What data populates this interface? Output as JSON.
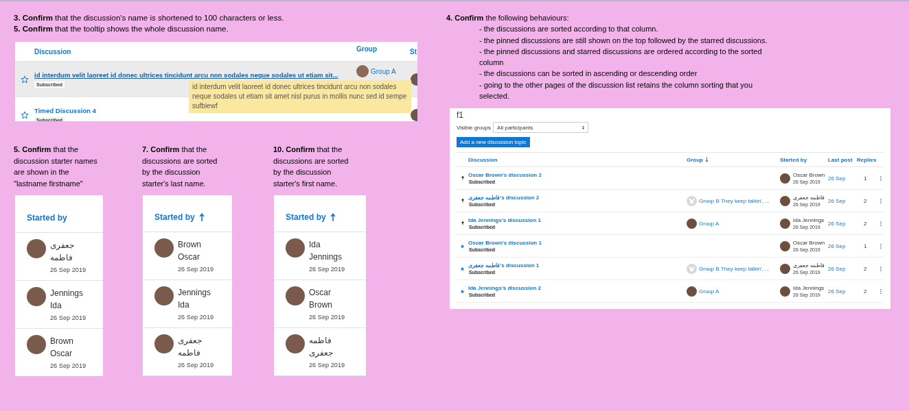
{
  "tooltip_step": {
    "instructions": [
      "**3. Confirm** that the discussion's name is shortened to 100 characters or less.",
      "**5. Confirm** that the tooltip shows the  whole discussion name."
    ],
    "columns": [
      {
        "label": "Discussion"
      },
      {
        "label": "Group"
      },
      {
        "label": "St"
      }
    ],
    "rows": [
      {
        "starred": false,
        "hovered": true,
        "title": "id interdum velit laoreet id donec ultrices tincidunt arcu non sodales neque sodales ut etiam sit...",
        "badge": "Subscribed",
        "group": "Group A"
      },
      {
        "starred": false,
        "hovered": false,
        "title": "Timed Discussion 4",
        "badge": "Subscribed"
      }
    ],
    "tooltip": "id interdum velit laoreet id donec ultrices tincidunt arcu non sodales neque sodales ut etiam sit amet nisl purus in mollis nunc sed id sempe sufbiewf"
  },
  "name_steps": [
    {
      "instruction": "**5. Confirm** that the discussion starter names are shown in the \"lastname firstname\"",
      "header": "Started by",
      "sorted": false,
      "entries": [
        {
          "name": "جعفری فاطمه",
          "date": "26 Sep 2019"
        },
        {
          "name": "Jennings Ida",
          "date": "26 Sep 2019"
        },
        {
          "name": "Brown Oscar",
          "date": "26 Sep 2019"
        }
      ]
    },
    {
      "instruction": "**7. Confirm** that the discussions are sorted by the discussion starter's last name.",
      "header": "Started by",
      "sorted": true,
      "descending": false,
      "entries": [
        {
          "name": "Brown Oscar",
          "date": "26 Sep 2019"
        },
        {
          "name": "Jennings Ida",
          "date": "26 Sep 2019"
        },
        {
          "name": "جعفری فاطمه",
          "date": "26 Sep 2019"
        }
      ]
    },
    {
      "instruction": "**10. Confirm** that the discussions are sorted by the discussion starter's first name.",
      "header": "Started by",
      "sorted": true,
      "descending": false,
      "entries": [
        {
          "name": "Ida Jennings",
          "date": "26 Sep 2019"
        },
        {
          "name": "Oscar Brown",
          "date": "26 Sep 2019"
        },
        {
          "name": "فاطمه جعفری",
          "date": "26 Sep 2019"
        }
      ]
    }
  ],
  "sort_step": {
    "intro": "**4. Confirm** the following behaviours:",
    "bullets": [
      "- the discussions are sorted according to that column.",
      "- the pinned discussions are still shown on the top followed by the starred discussions.",
      "- the pinned discussions and starred discussions are ordered according to the sorted column",
      "- the discussions can be sorted in ascending or descending order",
      "- going to the other pages of the discussion list retains the column sorting that you selected."
    ]
  },
  "forum": {
    "title": "f1",
    "groups_label": "Visible groups",
    "groups_value": "All participants",
    "add_button": "Add a new discussion topic",
    "columns": [
      {
        "label": "Discussion",
        "sorted": false
      },
      {
        "label": "Group",
        "sorted": true,
        "descending": true
      },
      {
        "label": "Started by",
        "sorted": false
      },
      {
        "label": "Last post",
        "sorted": false
      },
      {
        "label": "Replies",
        "sorted": false
      }
    ],
    "rows": [
      {
        "kind": "pinned",
        "title": "Oscar Brown's discussion 2",
        "badge": "Subscribed",
        "starter": "Oscar Brown",
        "started": "26 Sep 2019",
        "last_post": "26 Sep",
        "replies": "1"
      },
      {
        "kind": "pinned",
        "title": "فاطمه جعفری's discussion 2",
        "badge": "Subscribed",
        "group": "Group B They keep talkin', ...",
        "default_group_picture": true,
        "starter": "فاطمه جعفری",
        "started": "26 Sep 2019",
        "last_post": "26 Sep",
        "replies": "2"
      },
      {
        "kind": "pinned",
        "title": "Ida Jennings's discussion 1",
        "badge": "Subscribed",
        "group": "Group A",
        "default_group_picture": false,
        "starter": "Ida Jennings",
        "started": "26 Sep 2019",
        "last_post": "26 Sep",
        "replies": "2"
      },
      {
        "kind": "starred",
        "title": "Oscar Brown's discussion 1",
        "badge": "Subscribed",
        "starter": "Oscar Brown",
        "started": "26 Sep 2019",
        "last_post": "26 Sep",
        "replies": "1"
      },
      {
        "kind": "starred",
        "title": "فاطمه جعفری's discussion 1",
        "badge": "Subscribed",
        "group": "Group B They keep talkin', ...",
        "default_group_picture": true,
        "starter": "فاطمه جعفری",
        "started": "26 Sep 2019",
        "last_post": "26 Sep",
        "replies": "2"
      },
      {
        "kind": "starred",
        "title": "Ida Jennings's discussion 2",
        "badge": "Subscribed",
        "group": "Group A",
        "default_group_picture": false,
        "starter": "Ida Jennings",
        "started": "26 Sep 2019",
        "last_post": "26 Sep",
        "replies": "2"
      }
    ]
  }
}
